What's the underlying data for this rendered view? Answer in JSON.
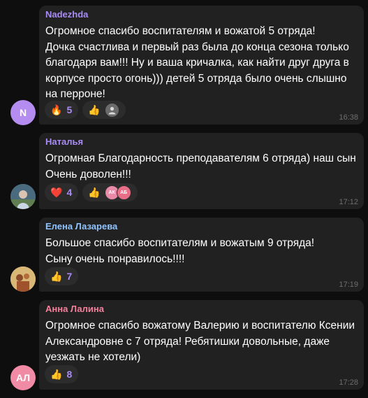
{
  "messages": [
    {
      "author": "Nadezhda",
      "author_color": "#a98bf5",
      "text": "Огромное спасибо воспитателям и вожатой 5 отряда!\nДочка счастлива и первый раз была до конца сезона только благодаря вам!!! Ну и ваша кричалка, как найти друг друга в корпусе просто огонь))) детей 5 отряда было очень слышно на перроне!",
      "avatar_initials": "N",
      "avatar_color": "#b58cf0",
      "reactions": [
        {
          "emoji": "🔥",
          "count": "5"
        },
        {
          "emoji": "👍",
          "count": "",
          "avatars": [
            {
              "initials": "",
              "color": "#6b6b6b"
            }
          ]
        }
      ],
      "time": "16:38"
    },
    {
      "author": "Наталья",
      "author_color": "#a98bf5",
      "text": "Огромная Благодарность преподавателям 6 отряда) наш сын Очень доволен!!!",
      "avatar_initials": "",
      "avatar_color": "#4f6e86",
      "reactions": [
        {
          "emoji": "❤️",
          "count": "4"
        },
        {
          "emoji": "👍",
          "count": "",
          "avatars": [
            {
              "initials": "АК",
              "color": "#e98aa8"
            },
            {
              "initials": "АБ",
              "color": "#e66e86"
            }
          ]
        }
      ],
      "time": "17:12"
    },
    {
      "author": "Елена Лазарева",
      "author_color": "#8fc4ff",
      "text": "Большое спасибо воспитателям и вожатым 9 отряда!\nСыну очень понравилось!!!!",
      "avatar_initials": "",
      "avatar_color": "#c9a262",
      "reactions": [
        {
          "emoji": "👍",
          "count": "7"
        }
      ],
      "time": "17:19"
    },
    {
      "author": "Анна Лалина",
      "author_color": "#f4819c",
      "text": "Огромное спасибо вожатому Валерию и воспитателю Ксении Александровне с 7 отряда! Ребятишки довольные, даже уезжать не хотели)",
      "avatar_initials": "АЛ",
      "avatar_color": "#f08aa5",
      "reactions": [
        {
          "emoji": "👍",
          "count": "8"
        }
      ],
      "time": "17:28"
    }
  ]
}
